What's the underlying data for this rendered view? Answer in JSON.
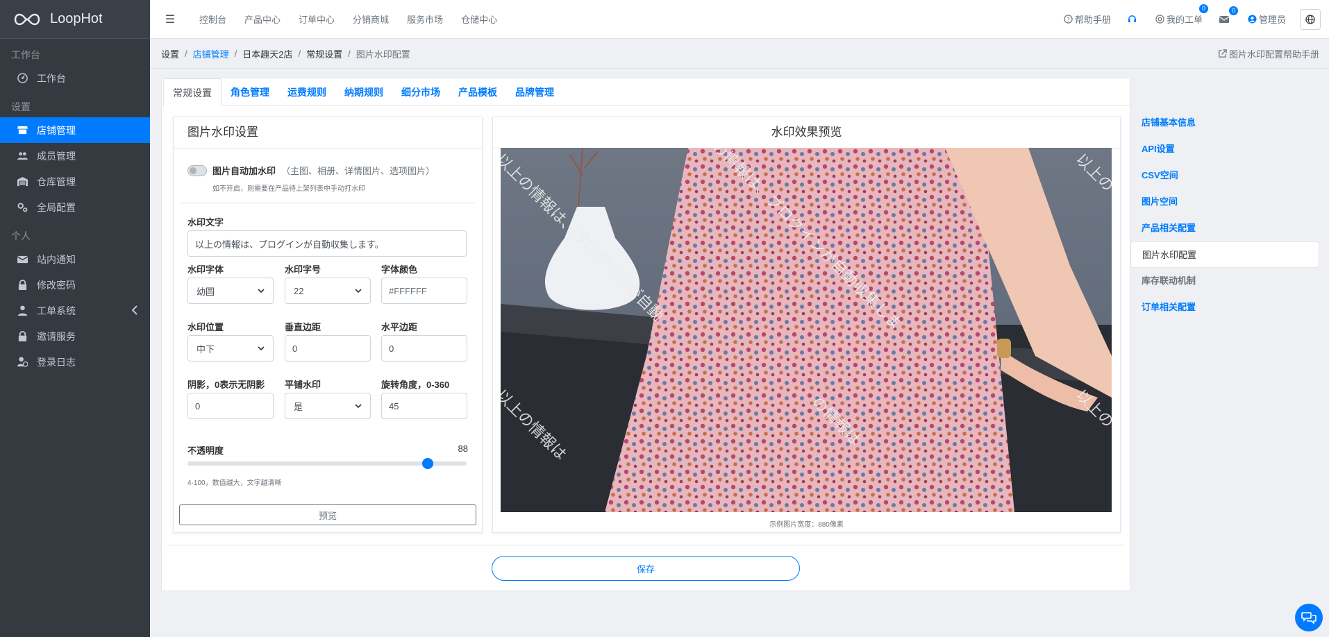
{
  "brand": {
    "name": "LoopHot"
  },
  "sidebar": {
    "sections": [
      {
        "header": "工作台",
        "items": [
          {
            "label": "工作台",
            "icon": "dashboard-icon"
          }
        ]
      },
      {
        "header": "设置",
        "items": [
          {
            "label": "店铺管理",
            "icon": "store-icon",
            "active": true
          },
          {
            "label": "成员管理",
            "icon": "users-icon"
          },
          {
            "label": "仓库管理",
            "icon": "warehouse-icon"
          },
          {
            "label": "全局配置",
            "icon": "cogs-icon"
          }
        ]
      },
      {
        "header": "个人",
        "items": [
          {
            "label": "站内通知",
            "icon": "envelope-icon"
          },
          {
            "label": "修改密码",
            "icon": "lock-icon"
          },
          {
            "label": "工单系统",
            "icon": "user-tie-icon",
            "has_caret": true
          },
          {
            "label": "邀请服务",
            "icon": "lock-icon"
          },
          {
            "label": "登录日志",
            "icon": "user-clock-icon"
          }
        ]
      }
    ]
  },
  "topbar": {
    "nav": [
      "控制台",
      "产品中心",
      "订单中心",
      "分销商城",
      "服务市场",
      "仓储中心"
    ],
    "help": "帮助手册",
    "tickets": "我的工单",
    "tickets_badge": "0",
    "mail_badge": "0",
    "admin": "管理员"
  },
  "breadcrumb": {
    "items": [
      "设置",
      "店铺管理",
      "日本趣天2店",
      "常规设置",
      "图片水印配置"
    ],
    "help": "图片水印配置帮助手册"
  },
  "tabs": [
    "常规设置",
    "角色管理",
    "运费规则",
    "纳期规则",
    "细分市场",
    "产品模板",
    "品牌管理"
  ],
  "settings": {
    "title": "图片水印设置",
    "auto_label": "图片自动加水印",
    "auto_hint": "（主图、相册、详情图片、选项图片）",
    "auto_sub": "如不开启，则需要在产品待上架列表中手动打水印",
    "text_label": "水印文字",
    "text_value": "以上の情報は、プログインが自動収集します。",
    "font_label": "水印字体",
    "font_value": "幼圆",
    "size_label": "水印字号",
    "size_value": "22",
    "color_label": "字体颜色",
    "color_placeholder": "#FFFFFF",
    "position_label": "水印位置",
    "position_value": "中下",
    "vmargin_label": "垂直边距",
    "vmargin_value": "0",
    "hmargin_label": "水平边距",
    "hmargin_value": "0",
    "shadow_label": "阴影，0表示无阴影",
    "shadow_value": "0",
    "tile_label": "平铺水印",
    "tile_value": "是",
    "rotate_label": "旋转角度，0-360",
    "rotate_value": "45",
    "opacity_label": "不透明度",
    "opacity_value": "88",
    "opacity_fraction": 0.86,
    "opacity_hint": "4-100，数值越大，文字越清晰",
    "preview_button": "预览"
  },
  "preview": {
    "title": "水印效果预览",
    "caption": "示例图片宽度：880像素",
    "watermark_fragments": [
      "以上の情報は、プログインが自動",
      "以上の情報は、プログインが自動収集しま",
      "以上の",
      "以上の情報は",
      "の情報は",
      "以上の"
    ]
  },
  "save_button": "保存",
  "right_nav": [
    {
      "label": "店铺基本信息"
    },
    {
      "label": "API设置"
    },
    {
      "label": "CSV空间"
    },
    {
      "label": "图片空间"
    },
    {
      "label": "产品相关配置"
    },
    {
      "label": "图片水印配置",
      "active": true
    },
    {
      "label": "库存联动机制",
      "muted": true
    },
    {
      "label": "订单相关配置"
    }
  ],
  "colors": {
    "accent": "#007bff",
    "sidebar": "#343a40"
  }
}
